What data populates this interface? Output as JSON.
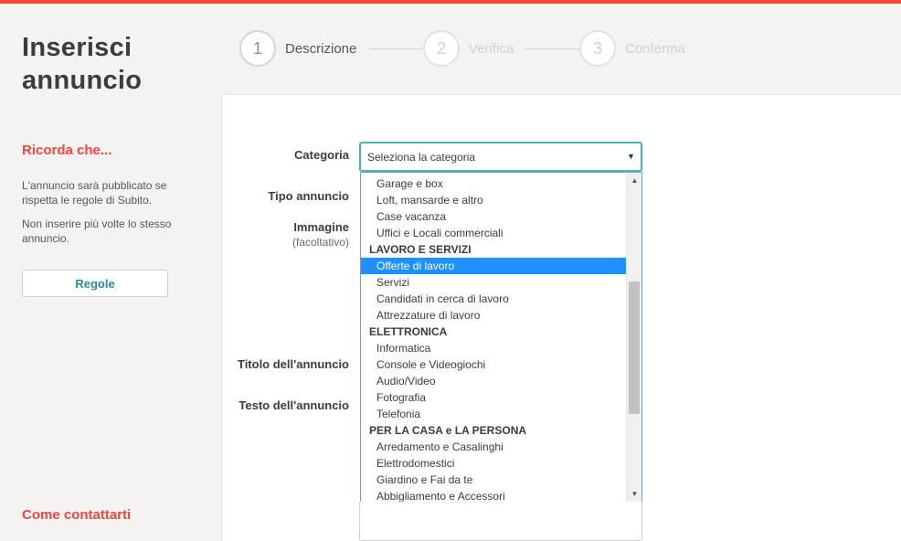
{
  "page": {
    "title_line1": "Inserisci",
    "title_line2": "annuncio"
  },
  "stepper": [
    {
      "number": "1",
      "label": "Descrizione"
    },
    {
      "number": "2",
      "label": "Verifica"
    },
    {
      "number": "3",
      "label": "Conferma"
    }
  ],
  "sidebar": {
    "reminder_title": "Ricorda che...",
    "reminder_text1": "L'annuncio sarà pubblicato se rispetta le regole di Subito.",
    "reminder_text2": "Non inserire più volte lo stesso annuncio.",
    "rules_button": "Regole",
    "contact_title": "Come contattarti"
  },
  "form": {
    "category_label": "Categoria",
    "category_value": "Seleziona la categoria",
    "type_label": "Tipo annuncio",
    "image_label": "Immagine",
    "image_optional": "(facoltativo)",
    "title_label": "Titolo dell'annuncio",
    "text_label": "Testo dell'annuncio"
  },
  "dropdown": {
    "items": [
      {
        "kind": "opt",
        "text": "Garage e box"
      },
      {
        "kind": "opt",
        "text": "Loft, mansarde e altro"
      },
      {
        "kind": "opt",
        "text": "Case vacanza"
      },
      {
        "kind": "opt",
        "text": "Uffici e Locali commerciali"
      },
      {
        "kind": "grp",
        "text": "LAVORO E SERVIZI"
      },
      {
        "kind": "opt",
        "text": "Offerte di lavoro",
        "selected": true
      },
      {
        "kind": "opt",
        "text": "Servizi"
      },
      {
        "kind": "opt",
        "text": "Candidati in cerca di lavoro"
      },
      {
        "kind": "opt",
        "text": "Attrezzature di lavoro"
      },
      {
        "kind": "grp",
        "text": "ELETTRONICA"
      },
      {
        "kind": "opt",
        "text": "Informatica"
      },
      {
        "kind": "opt",
        "text": "Console e Videogiochi"
      },
      {
        "kind": "opt",
        "text": "Audio/Video"
      },
      {
        "kind": "opt",
        "text": "Fotografia"
      },
      {
        "kind": "opt",
        "text": "Telefonia"
      },
      {
        "kind": "grp",
        "text": "PER LA CASA e LA PERSONA"
      },
      {
        "kind": "opt",
        "text": "Arredamento e Casalinghi"
      },
      {
        "kind": "opt",
        "text": "Elettrodomestici"
      },
      {
        "kind": "opt",
        "text": "Giardino e Fai da te"
      },
      {
        "kind": "opt",
        "text": "Abbigliamento e Accessori"
      }
    ]
  },
  "colors": {
    "accent": "#f2453d",
    "focus": "#4bb3b3",
    "selected": "#1e90ff",
    "link": "#2a8d9a"
  },
  "icons": {
    "select_arrow": "caret-down-icon",
    "scroll_up": "scroll-up-icon",
    "scroll_down": "scroll-down-icon"
  }
}
